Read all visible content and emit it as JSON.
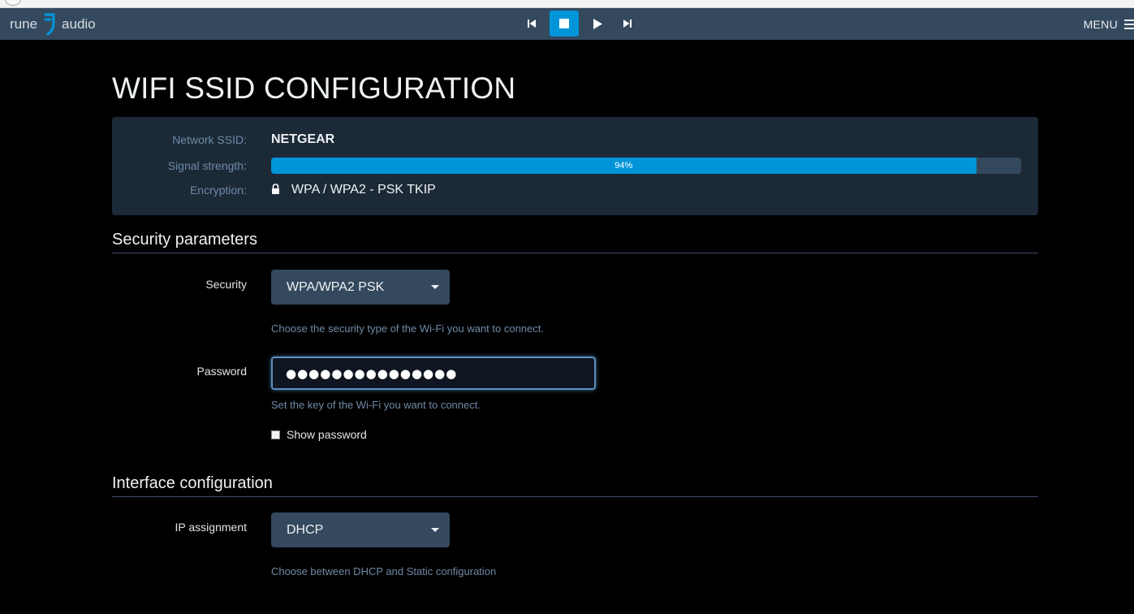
{
  "app": {
    "logo_left": "rune",
    "logo_right": "audio",
    "menu_label": "MENU"
  },
  "player": {
    "controls": [
      "previous-icon",
      "stop-icon",
      "play-icon",
      "next-icon"
    ],
    "active_control": "stop",
    "accent": "#0095d8"
  },
  "page": {
    "title": "WIFI SSID CONFIGURATION"
  },
  "network": {
    "ssid_label": "Network SSID:",
    "ssid_value": "NETGEAR",
    "signal_label": "Signal strength:",
    "signal_value": 94,
    "signal_text": "94%",
    "encryption_label": "Encryption:",
    "encryption_value": "WPA / WPA2 - PSK TKIP"
  },
  "security": {
    "heading": "Security parameters",
    "security_label": "Security",
    "security_value": "WPA/WPA2 PSK",
    "security_help": "Choose the security type of the Wi-Fi you want to connect.",
    "password_label": "Password",
    "password_value": "●●●●●●●●●●●●●●●",
    "password_help": "Set the key of the Wi-Fi you want to connect.",
    "show_password_label": "Show password"
  },
  "interface": {
    "heading": "Interface configuration",
    "ip_label": "IP assignment",
    "ip_value": "DHCP",
    "ip_help": "Choose between DHCP and Static configuration"
  }
}
